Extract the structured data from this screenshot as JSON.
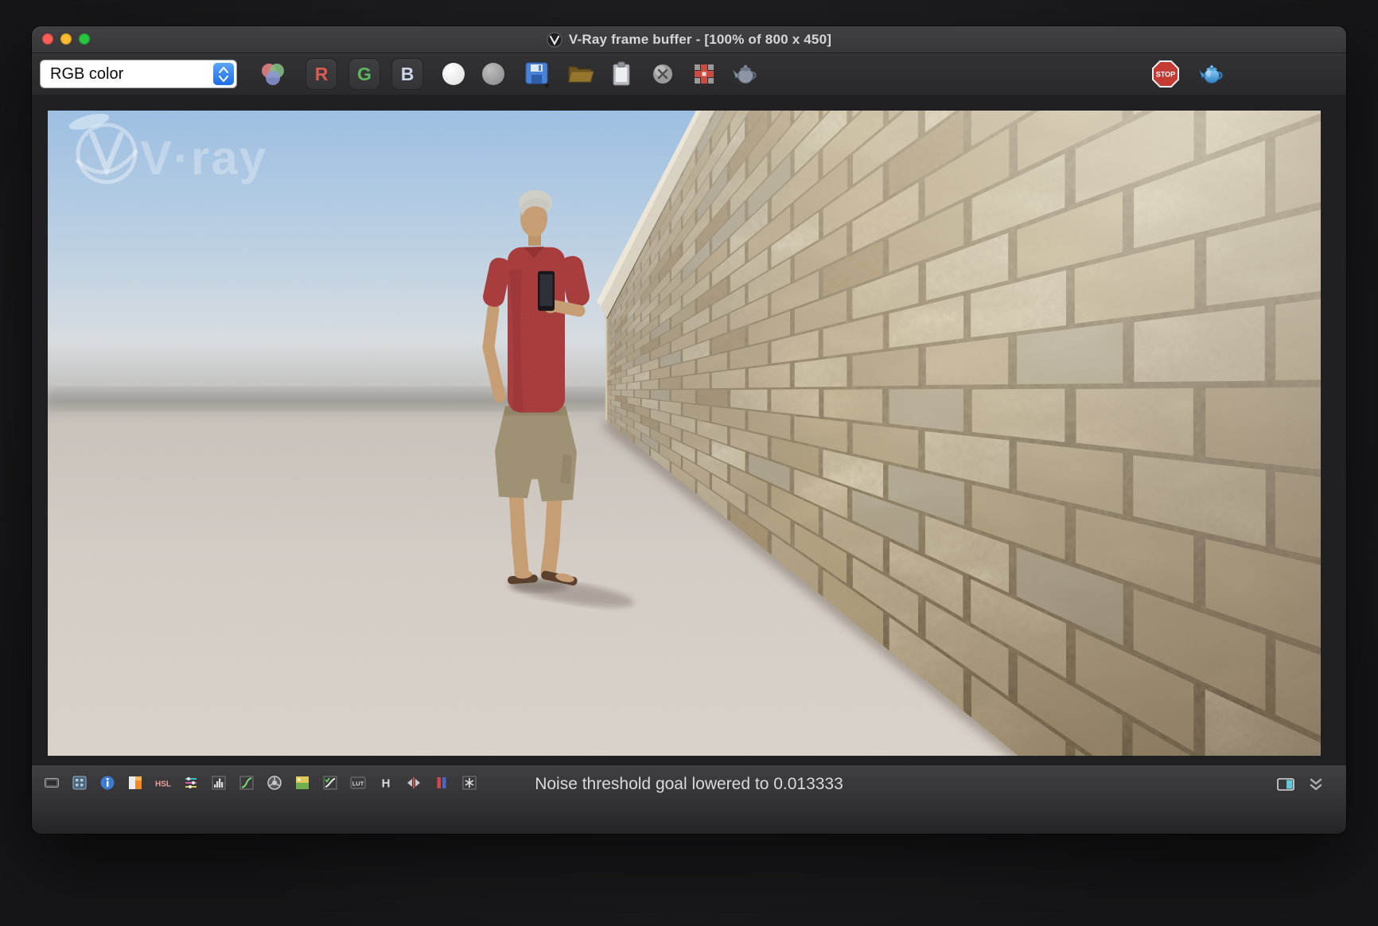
{
  "window": {
    "title": "V-Ray frame buffer - [100% of 800 x 450]",
    "traffic_lights": [
      "close",
      "minimize",
      "zoom"
    ]
  },
  "toolbar": {
    "channel_select": {
      "value": "RGB color"
    },
    "red_label": "R",
    "green_label": "G",
    "blue_label": "B",
    "stop_label": "STOP",
    "icons": [
      "rgb-channels",
      "red-channel",
      "green-channel",
      "blue-channel",
      "white-mode",
      "mono-mode",
      "save-image",
      "open-image",
      "copy-to-clipboard",
      "clear-image",
      "track-mouse",
      "render-last",
      "stop-render",
      "interactive-render"
    ]
  },
  "viewport": {
    "watermark_text": "V·ray",
    "zoom_percent": "100%",
    "image_size": "800 x 450"
  },
  "statusbar": {
    "message": "Noise threshold goal lowered to 0.013333",
    "hsl_label": "HSL",
    "lut_label": "LUT",
    "history_label": "H",
    "icons": [
      "display-correction",
      "pixel-information",
      "image-info",
      "color-corrections",
      "hsl",
      "color-balance",
      "levels",
      "curve-control",
      "white-balance",
      "background-image",
      "ocio",
      "lut",
      "history",
      "compare-ab",
      "stereo",
      "sharpen",
      "corrections-panel",
      "collapse"
    ]
  },
  "colors": {
    "accent_blue": "#1f6ce6",
    "traffic": {
      "close": "#ff5f57",
      "minimize": "#febc2e",
      "zoom": "#28c840"
    },
    "shirt_red": "#a83c3c",
    "shorts_khaki": "#9f9273",
    "skin": "#c79e73",
    "wall_palette": [
      "#cfbf9f",
      "#c5b391",
      "#d6c9aa",
      "#bcab87",
      "#cbbb9a",
      "#d2c5a5",
      "#c0ae8a",
      "#c9b895",
      "#dbd0b4",
      "#b5a37e",
      "#cdbd9e",
      "#c2b08c",
      "#b8b09c",
      "#a8906a"
    ]
  }
}
